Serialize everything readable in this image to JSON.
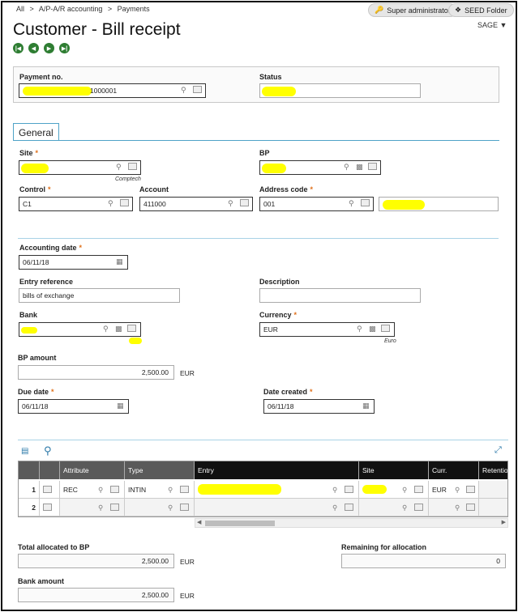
{
  "breadcrumb": [
    "All",
    ">",
    "A/P-A/R accounting",
    ">",
    "Payments"
  ],
  "topbar": {
    "user_label": "Super administrator",
    "folder_label": "SEED Folder",
    "sage_label": "SAGE ▼"
  },
  "page": {
    "title": "Customer - Bill receipt"
  },
  "header": {
    "payment_no_label": "Payment no.",
    "payment_no_value": "1000001",
    "status_label": "Status",
    "status_value": ""
  },
  "tabs": {
    "general": "General"
  },
  "form": {
    "site_label": "Site",
    "site_value": "",
    "site_sub": "Comptech",
    "bp_label": "BP",
    "bp_value": "",
    "control_label": "Control",
    "control_value": "C1",
    "account_label": "Account",
    "account_value": "411000",
    "address_label": "Address code",
    "address_value": "001",
    "address_desc": "",
    "accdate_label": "Accounting date",
    "accdate_value": "06/11/18",
    "entryref_label": "Entry reference",
    "entryref_value": "bills of exchange",
    "desc_label": "Description",
    "desc_value": "",
    "bank_label": "Bank",
    "bank_value": "",
    "currency_label": "Currency",
    "currency_value": "EUR",
    "currency_sub": "Euro",
    "bpamount_label": "BP amount",
    "bpamount_value": "2,500.00",
    "bpamount_cur": "EUR",
    "duedate_label": "Due date",
    "duedate_value": "06/11/18",
    "datecreated_label": "Date created",
    "datecreated_value": "06/11/18"
  },
  "grid": {
    "headers": [
      "Attribute",
      "Type",
      "Entry",
      "Site",
      "Curr.",
      "Retentio"
    ],
    "rows": [
      {
        "num": "1",
        "attribute": "REC",
        "type": "INTIN",
        "entry": "",
        "site": "",
        "curr": "EUR"
      },
      {
        "num": "2",
        "attribute": "",
        "type": "",
        "entry": "",
        "site": "",
        "curr": ""
      }
    ]
  },
  "totals": {
    "allocated_label": "Total allocated to BP",
    "allocated_value": "2,500.00",
    "allocated_cur": "EUR",
    "remaining_label": "Remaining for allocation",
    "remaining_value": "0",
    "bankamount_label": "Bank amount",
    "bankamount_value": "2,500.00",
    "bankamount_cur": "EUR"
  },
  "colors": {
    "highlight": "#ffff00",
    "required": "#e0701a",
    "nav": "#2e7d32",
    "tabline": "#4fa3c7"
  }
}
